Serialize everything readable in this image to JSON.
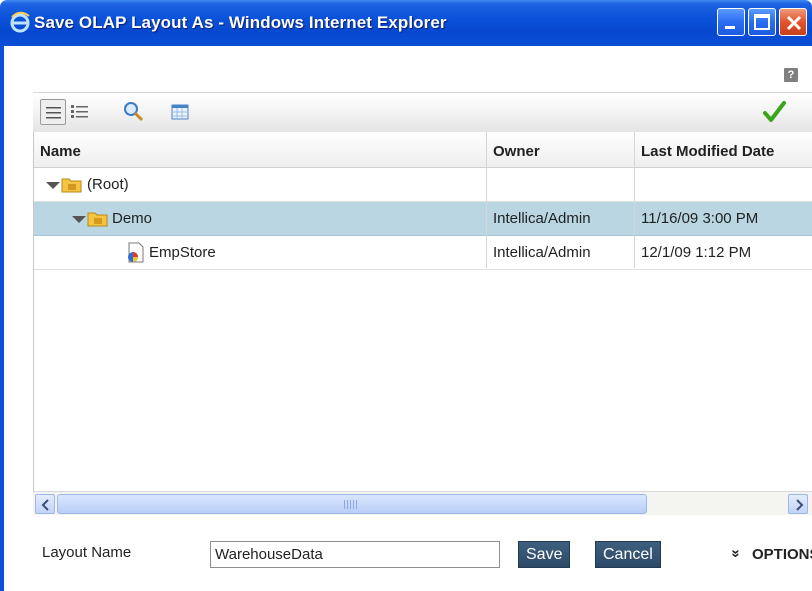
{
  "window": {
    "title": "Save OLAP Layout As - Windows Internet Explorer"
  },
  "help": {
    "label": "?"
  },
  "toolbar": {
    "buttons": [
      {
        "icon": "list-view-icon",
        "active": true
      },
      {
        "icon": "details-view-icon",
        "active": false
      },
      {
        "icon": "search-icon",
        "active": false
      },
      {
        "icon": "table-icon",
        "active": false
      }
    ],
    "confirm_icon": "checkmark-icon"
  },
  "grid": {
    "columns": [
      "Name",
      "Owner",
      "Last Modified Date"
    ],
    "rows": [
      {
        "name": "(Root)",
        "owner": "",
        "modified": "",
        "type": "folder",
        "level": 0,
        "expanded": true,
        "selected": false
      },
      {
        "name": "Demo",
        "owner": "Intellica/Admin",
        "modified": "11/16/09 3:00 PM",
        "type": "folder",
        "level": 1,
        "expanded": true,
        "selected": true
      },
      {
        "name": "EmpStore",
        "owner": "Intellica/Admin",
        "modified": "12/1/09 1:12 PM",
        "type": "layout",
        "level": 2,
        "expanded": false,
        "selected": false
      }
    ]
  },
  "footer": {
    "layout_name_label": "Layout Name",
    "layout_name_value": "WarehouseData",
    "save_label": "Save",
    "cancel_label": "Cancel",
    "options_label": "OPTIONS",
    "options_chevron": "»"
  },
  "colors": {
    "titlebar": "#0a52da",
    "selected_row": "#b9d6e2",
    "button": "#2f4e6d",
    "check": "#3aa51b"
  }
}
